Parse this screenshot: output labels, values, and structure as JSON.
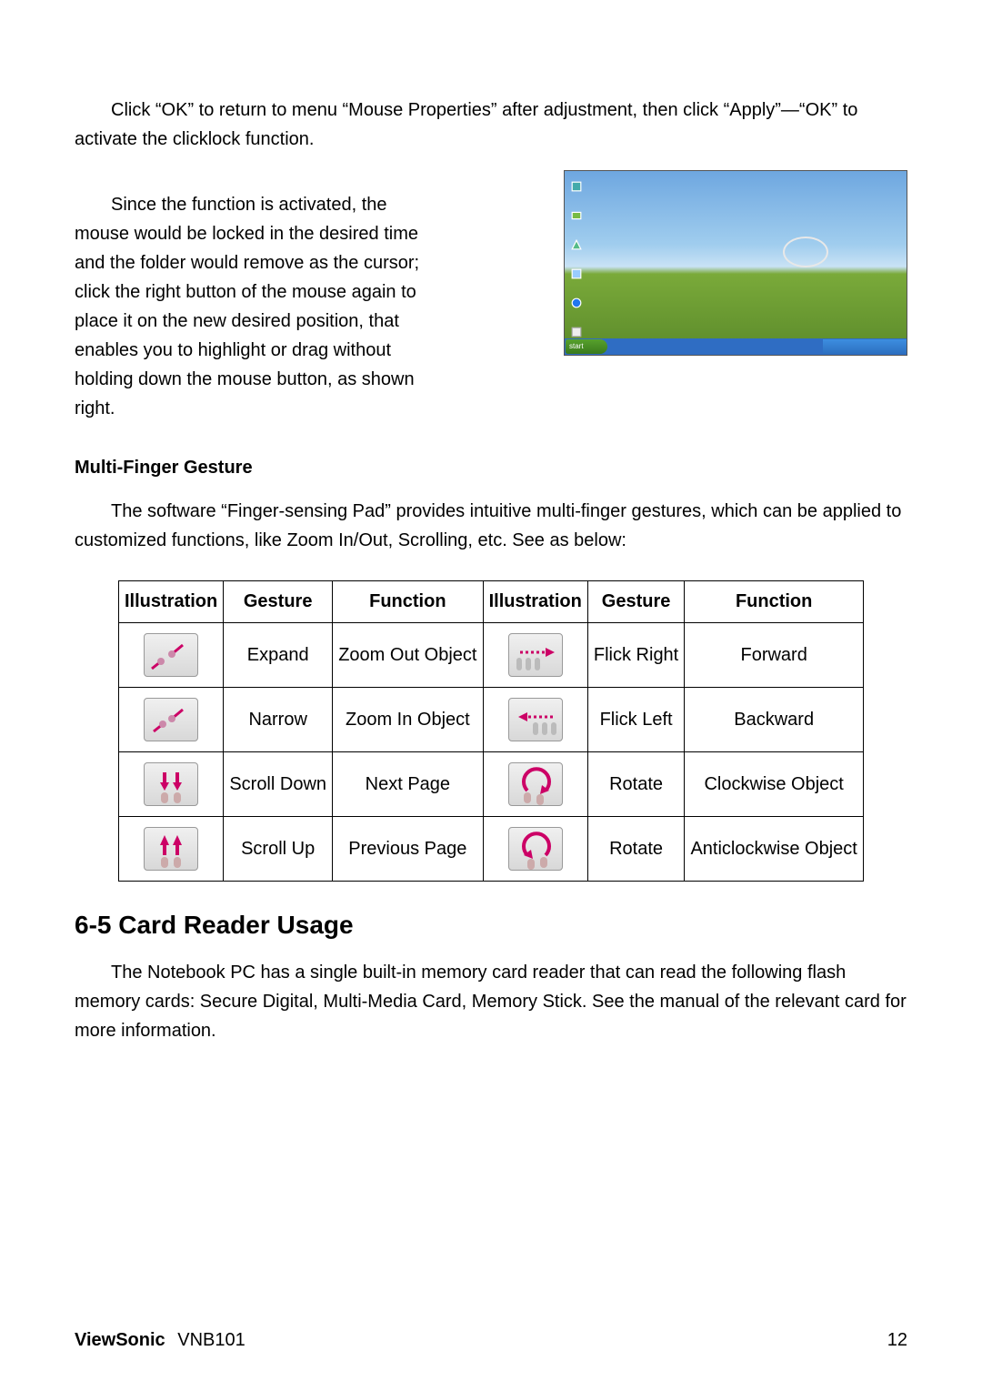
{
  "intro_para": "Click “OK” to return to menu “Mouse Properties” after adjustment, then click “Apply”—“OK” to activate the clicklock function.",
  "activated_para": "Since the function is activated, the mouse would be locked in the desired time and the folder would remove as the cursor; click the right button of the mouse again to place it on the new desired position, that enables you to highlight or drag without holding down the mouse button, as shown right.",
  "multi_finger_heading": "Multi-Finger Gesture",
  "multi_finger_para": "The software “Finger-sensing Pad” provides intuitive multi-finger gestures, which can be applied to customized functions, like Zoom In/Out, Scrolling, etc. See as below:",
  "table": {
    "headers": {
      "illustration": "Illustration",
      "gesture": "Gesture",
      "function": "Function"
    },
    "rows": [
      {
        "gesture_l": "Expand",
        "function_l": "Zoom Out Object",
        "gesture_r": "Flick Right",
        "function_r": "Forward"
      },
      {
        "gesture_l": "Narrow",
        "function_l": "Zoom In Object",
        "gesture_r": "Flick Left",
        "function_r": "Backward"
      },
      {
        "gesture_l": "Scroll Down",
        "function_l": "Next Page",
        "gesture_r": "Rotate",
        "function_r": "Clockwise Object"
      },
      {
        "gesture_l": "Scroll Up",
        "function_l": "Previous Page",
        "gesture_r": "Rotate",
        "function_r": "Anticlockwise Object"
      }
    ]
  },
  "card_heading": "6-5 Card Reader Usage",
  "card_para": "The Notebook PC has a single built-in memory card reader that can read the following flash memory cards: Secure Digital, Multi-Media Card, Memory Stick. See the manual of the relevant card for more information.",
  "footer": {
    "brand": "ViewSonic",
    "model": "VNB101",
    "page": "12"
  },
  "screenshot": {
    "start_label": "start"
  }
}
